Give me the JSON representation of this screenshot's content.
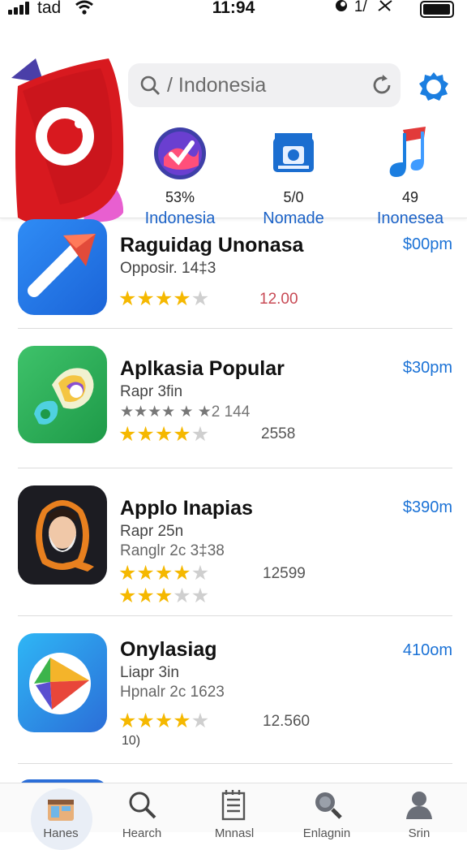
{
  "status_bar": {
    "carrier": "tad",
    "time": "11:94",
    "right_text": "1/"
  },
  "search": {
    "placeholder": "/ Indonesia"
  },
  "categories": [
    {
      "percent": "53%",
      "label": "Indonesia",
      "icon": "purple-check-icon"
    },
    {
      "percent": "5/0",
      "label": "Nomade",
      "icon": "blue-camera-icon"
    },
    {
      "percent": "49",
      "label": "Inonesea",
      "icon": "blue-music-note-icon"
    }
  ],
  "apps": [
    {
      "name": "Raguidag Unonasa",
      "price": "$00pm",
      "lines": [
        "Opposir. 14‡3"
      ],
      "rating": 4,
      "value": "12.00",
      "value_color": "#c84a55",
      "icon": "paper-plane-icon"
    },
    {
      "name": "Aplkasia Popular",
      "price": "$30pm",
      "lines": [
        "Rapr 3fin",
        "★★★★ ★ ★2 144"
      ],
      "rating": 4,
      "value": "2558",
      "value_color": "#555555",
      "icon": "colorful-swirl-icon"
    },
    {
      "name": "Applo Inapias",
      "price": "$390m",
      "lines": [
        "Rapr 25n",
        "Ranglr 2c 3‡38"
      ],
      "rating": 4,
      "rating2": 3,
      "value": "12599",
      "value_color": "#555555",
      "icon": "bearded-man-avatar-icon"
    },
    {
      "name": "Onylasiag",
      "price": "410om",
      "lines": [
        "Liapr 3in",
        "Hpnalr 2c 1623"
      ],
      "rating": 4,
      "value": "12.560",
      "value_color": "#555555",
      "extra": "10)",
      "icon": "play-triangle-icon"
    }
  ],
  "tabs": [
    {
      "label": "Hanes",
      "icon": "app-grid-icon",
      "active": true
    },
    {
      "label": "Hearch",
      "icon": "search-icon"
    },
    {
      "label": "Mnnasl",
      "icon": "list-doc-icon"
    },
    {
      "label": "Enlagnin",
      "icon": "magnifier-icon"
    },
    {
      "label": "Srin",
      "icon": "person-icon"
    }
  ],
  "colors": {
    "accent": "#1b72d6",
    "star": "#f5b800",
    "logo_red": "#d8191f"
  }
}
